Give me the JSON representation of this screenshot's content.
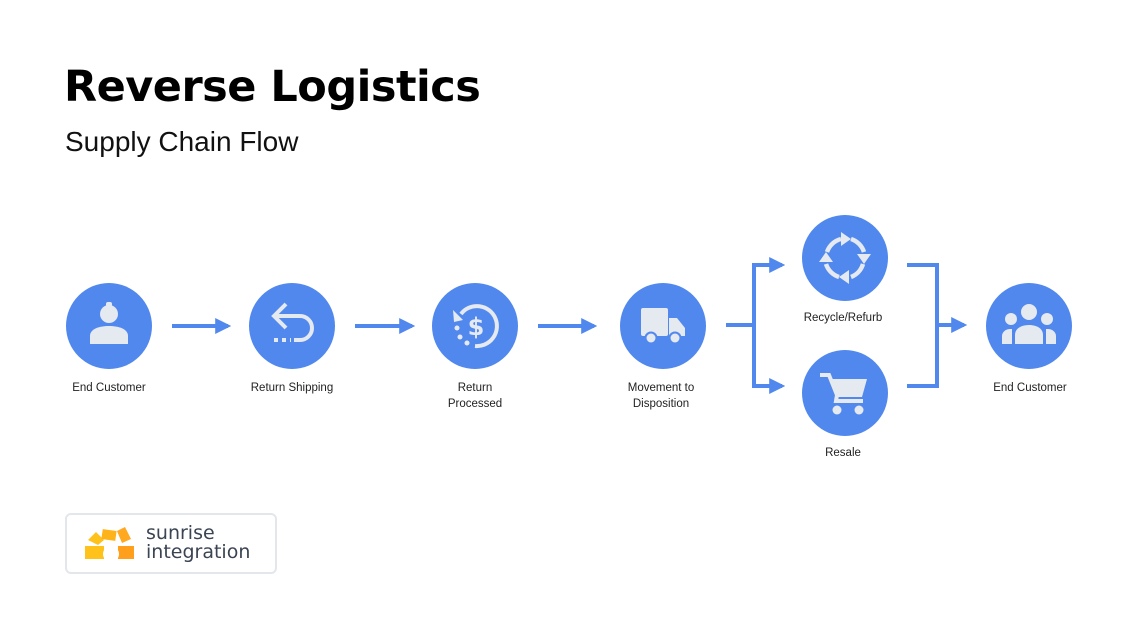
{
  "header": {
    "title": "Reverse Logistics",
    "subtitle": "Supply Chain Flow"
  },
  "colors": {
    "node_fill": "#5188ee",
    "icon_fill": "#e5e9f0",
    "connector": "#5188ee",
    "logo_yellow": "#ffc21a",
    "logo_orange": "#ff9f1c"
  },
  "flow": {
    "nodes": [
      {
        "id": "end-customer-start",
        "label_lines": [
          "End Customer"
        ],
        "icon": "person-icon"
      },
      {
        "id": "return-shipping",
        "label_lines": [
          "Return Shipping"
        ],
        "icon": "return-arrow-icon"
      },
      {
        "id": "return-processed",
        "label_lines": [
          "Return",
          "Processed"
        ],
        "icon": "refund-dollar-icon"
      },
      {
        "id": "movement-to-disposition",
        "label_lines": [
          "Movement to",
          "Disposition"
        ],
        "icon": "truck-icon"
      },
      {
        "id": "recycle-refurb",
        "label_lines": [
          "Recycle/Refurb"
        ],
        "icon": "recycle-icon"
      },
      {
        "id": "resale",
        "label_lines": [
          "Resale"
        ],
        "icon": "shopping-cart-icon"
      },
      {
        "id": "end-customer-end",
        "label_lines": [
          "End Customer"
        ],
        "icon": "group-icon"
      }
    ],
    "edges": [
      [
        "end-customer-start",
        "return-shipping"
      ],
      [
        "return-shipping",
        "return-processed"
      ],
      [
        "return-processed",
        "movement-to-disposition"
      ],
      [
        "movement-to-disposition",
        "recycle-refurb"
      ],
      [
        "movement-to-disposition",
        "resale"
      ],
      [
        "recycle-refurb",
        "end-customer-end"
      ],
      [
        "resale",
        "end-customer-end"
      ]
    ]
  },
  "logo": {
    "line1": "sunrise",
    "line2": "integration"
  }
}
